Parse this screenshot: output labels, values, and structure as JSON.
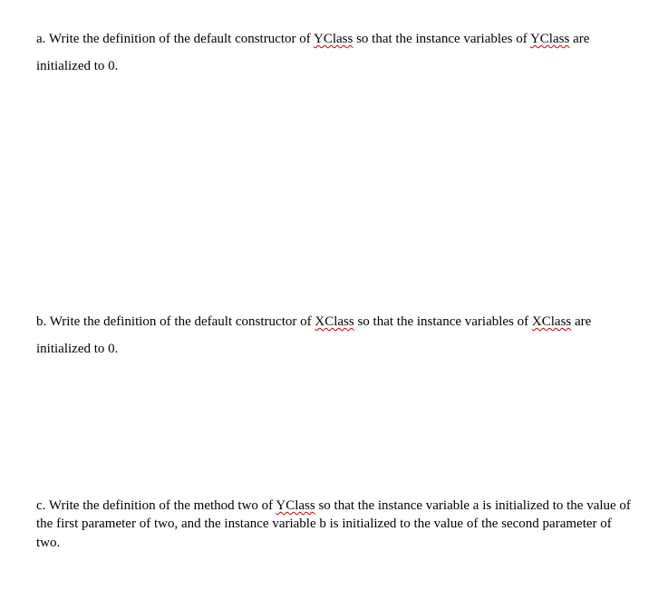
{
  "q_a": {
    "label": "a.",
    "t1": "Write the definition of the default constructor of ",
    "w1": "YClass",
    "t2": " so that the instance variables of ",
    "w2": "YClass",
    "t3": " are initialized to 0."
  },
  "q_b": {
    "label": "b.",
    "t1": "Write the definition of the default constructor of ",
    "w1": "XClass",
    "t2": " so that the instance variables of ",
    "w2": "XClass",
    "t3": " are initialized to 0."
  },
  "q_c": {
    "label": "c.",
    "t1": "Write the definition of the method two of ",
    "w1": "YClass",
    "t2": " so that the instance variable a is initialized to the value of the first parameter of two, and the instance variable b is initialized to the value of the second parameter of two."
  }
}
